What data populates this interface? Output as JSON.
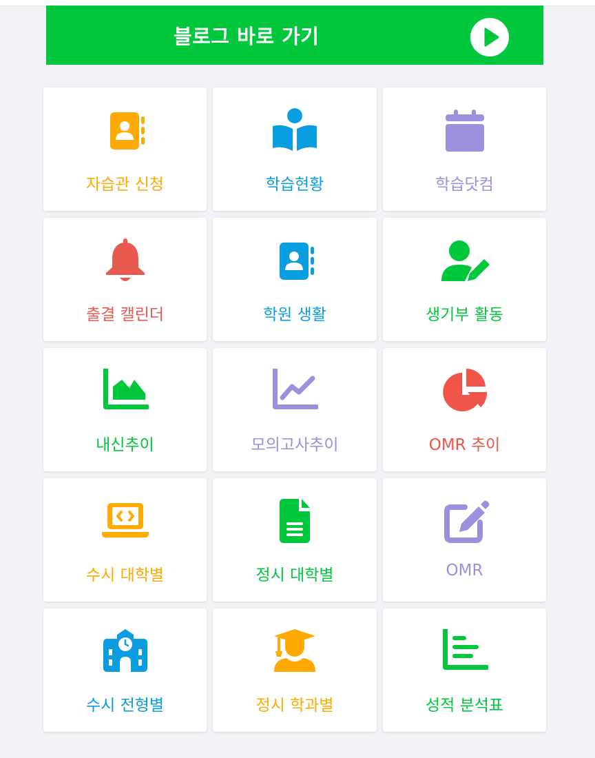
{
  "banner": {
    "title": "블로그 바로 가기",
    "color": "#00c73c"
  },
  "tiles": [
    {
      "label": "자습관 신청",
      "icon": "contact-book-icon",
      "color": "#ffaa00"
    },
    {
      "label": "학습현황",
      "icon": "book-reader-icon",
      "color": "#0a9ee0"
    },
    {
      "label": "학습닷컴",
      "icon": "calendar-icon",
      "color": "#9d8fdb"
    },
    {
      "label": "출결 캘린더",
      "icon": "bell-icon",
      "color": "#e85a4f"
    },
    {
      "label": "학원 생활",
      "icon": "contact-book-icon",
      "color": "#0a9ee0"
    },
    {
      "label": "생기부 활동",
      "icon": "user-pen-icon",
      "color": "#00c73c"
    },
    {
      "label": "내신추이",
      "icon": "area-chart-icon",
      "color": "#00c73c"
    },
    {
      "label": "모의고사추이",
      "icon": "line-chart-icon",
      "color": "#9d8fdb"
    },
    {
      "label": "OMR 추이",
      "icon": "pie-chart-icon",
      "color": "#f0554a"
    },
    {
      "label": "수시 대학별",
      "icon": "laptop-code-icon",
      "color": "#ffaa00"
    },
    {
      "label": "정시 대학별",
      "icon": "file-lines-icon",
      "color": "#00c73c"
    },
    {
      "label": "OMR",
      "icon": "pen-to-square-icon",
      "color": "#9d8fdb"
    },
    {
      "label": "수시 전형별",
      "icon": "school-icon",
      "color": "#0a9ee0"
    },
    {
      "label": "정시 학과별",
      "icon": "graduate-icon",
      "color": "#ffaa00"
    },
    {
      "label": "성적 분석표",
      "icon": "bar-chart-icon",
      "color": "#00c73c"
    }
  ]
}
